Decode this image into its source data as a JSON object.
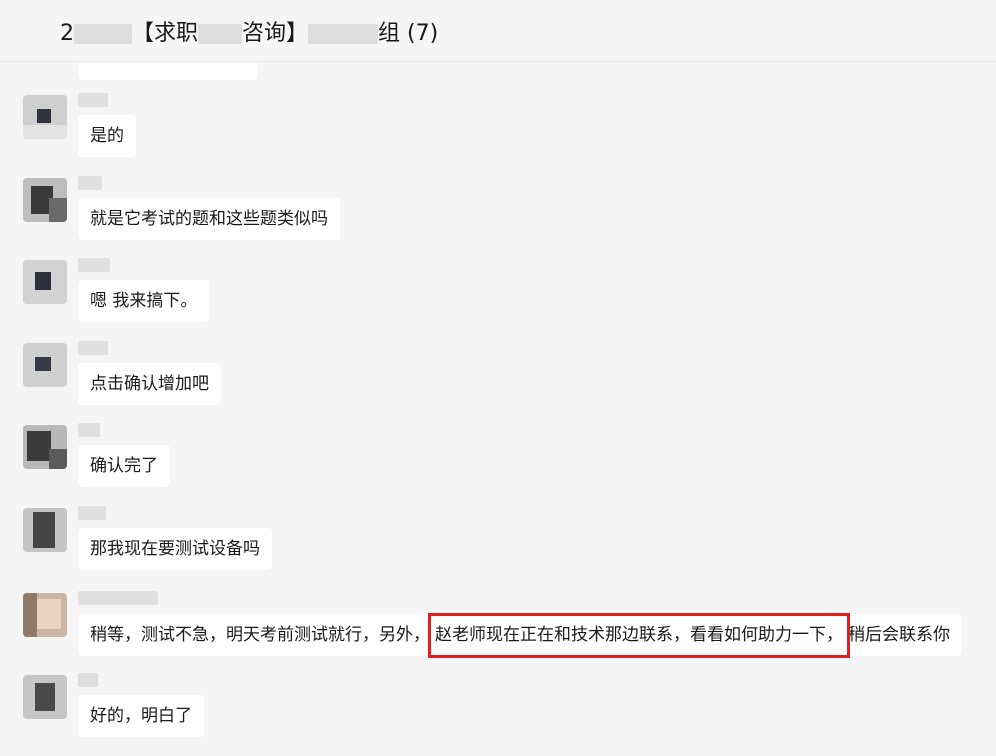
{
  "header": {
    "title_prefix": "2",
    "title_mid": "【求职",
    "title_mid2": "咨询】",
    "title_suffix": "组 (7)"
  },
  "messages": [
    {
      "text": "是的",
      "avatar": "blurred-avatar"
    },
    {
      "text": "就是它考试的题和这些题类似吗",
      "avatar": "blurred-avatar"
    },
    {
      "text": "嗯 我来搞下。",
      "avatar": "blurred-avatar"
    },
    {
      "text": "点击确认增加吧",
      "avatar": "blurred-avatar"
    },
    {
      "text": "确认完了",
      "avatar": "blurred-avatar"
    },
    {
      "text": "那我现在要测试设备吗",
      "avatar": "blurred-avatar"
    },
    {
      "text_before": "稍等，测试不急，明天考前测试就行，另外，",
      "text_highlight": "赵老师现在正在和技术那边联系，看看如何助力一下，",
      "text_after": "稍后会联系你",
      "avatar": "blurred-avatar"
    },
    {
      "text": "好的，明白了",
      "avatar": "blurred-avatar"
    }
  ],
  "colors": {
    "background": "#f5f5f5",
    "bubble": "#ffffff",
    "highlight_border": "#e02020",
    "text": "#191919"
  }
}
